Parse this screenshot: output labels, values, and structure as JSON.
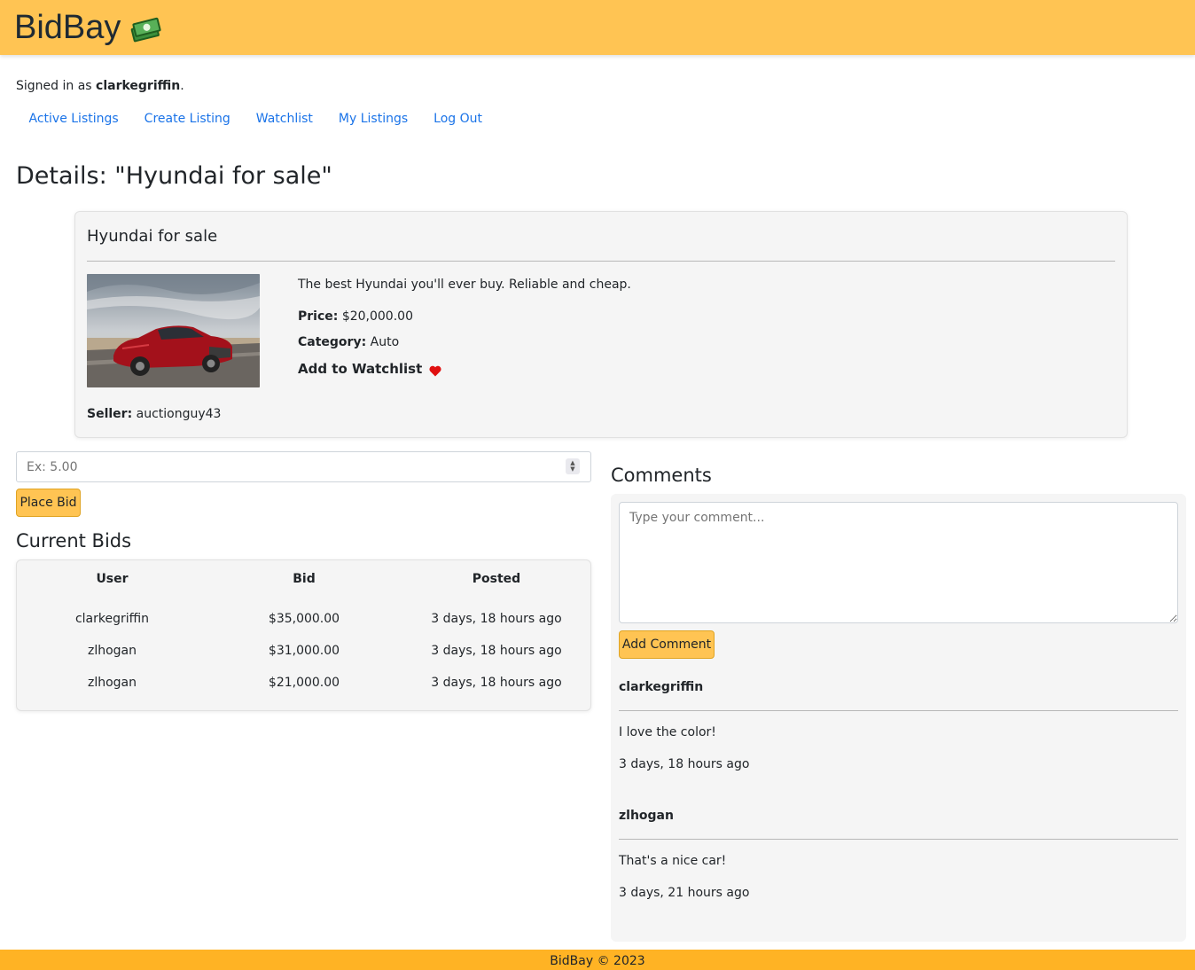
{
  "header": {
    "brand": "BidBay",
    "brand_icon": "money-icon",
    "color": "#ffc453"
  },
  "user": {
    "signed_in_prefix": "Signed in as",
    "username": "clarkegriffin",
    "signed_in_suffix": "."
  },
  "nav": {
    "items": [
      "Active Listings",
      "Create Listing",
      "Watchlist",
      "My Listings",
      "Log Out"
    ]
  },
  "page_title": "Details: \"Hyundai for sale\"",
  "listing": {
    "title": "Hyundai for sale",
    "description": "The best Hyundai you'll ever buy. Reliable and cheap.",
    "price_label": "Price:",
    "price": "$20,000.00",
    "category_label": "Category:",
    "category": "Auto",
    "watchlist_label": "Add to Watchlist",
    "watchlist_icon": "heart-icon",
    "seller_label": "Seller:",
    "seller": "auctionguy43"
  },
  "bid_form": {
    "placeholder": "Ex: 5.00",
    "button": "Place Bid"
  },
  "bids": {
    "heading": "Current Bids",
    "columns": [
      "User",
      "Bid",
      "Posted"
    ],
    "rows": [
      {
        "user": "clarkegriffin",
        "bid": "$35,000.00",
        "posted": "3 days, 18 hours ago"
      },
      {
        "user": "zlhogan",
        "bid": "$31,000.00",
        "posted": "3 days, 18 hours ago"
      },
      {
        "user": "zlhogan",
        "bid": "$21,000.00",
        "posted": "3 days, 18 hours ago"
      }
    ]
  },
  "comments": {
    "heading": "Comments",
    "placeholder": "Type your comment...",
    "button": "Add Comment",
    "items": [
      {
        "author": "clarkegriffin",
        "text": "I love the color!",
        "time": "3 days, 18 hours ago"
      },
      {
        "author": "zlhogan",
        "text": "That's a nice car!",
        "time": "3 days, 21 hours ago"
      }
    ]
  },
  "footer": "BidBay © 2023"
}
